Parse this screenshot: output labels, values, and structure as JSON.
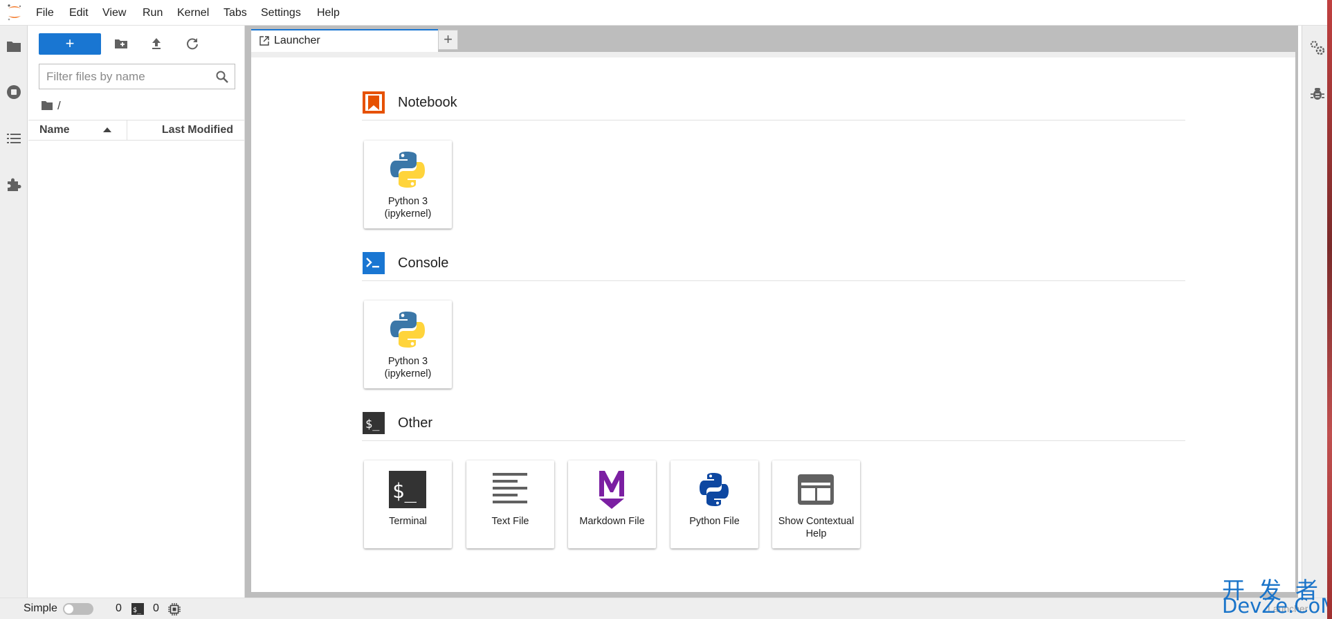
{
  "menubar": {
    "items": [
      "File",
      "Edit",
      "View",
      "Run",
      "Kernel",
      "Tabs",
      "Settings",
      "Help"
    ]
  },
  "file_browser": {
    "new_button_label": "+",
    "filter_placeholder": "Filter files by name",
    "breadcrumb": "/",
    "columns": {
      "name": "Name",
      "last_modified": "Last Modified"
    }
  },
  "tabs": [
    {
      "label": "Launcher",
      "active": true
    }
  ],
  "add_tab_label": "+",
  "launcher": {
    "sections": [
      {
        "title": "Notebook",
        "cards": [
          {
            "label": "Python 3\n(ipykernel)",
            "icon": "python-logo-icon"
          }
        ]
      },
      {
        "title": "Console",
        "cards": [
          {
            "label": "Python 3\n(ipykernel)",
            "icon": "python-logo-icon"
          }
        ]
      },
      {
        "title": "Other",
        "cards": [
          {
            "label": "Terminal",
            "icon": "terminal-icon"
          },
          {
            "label": "Text File",
            "icon": "text-file-icon"
          },
          {
            "label": "Markdown File",
            "icon": "markdown-icon"
          },
          {
            "label": "Python File",
            "icon": "python-file-icon"
          },
          {
            "label": "Show Contextual\nHelp",
            "icon": "contextual-help-icon"
          }
        ]
      }
    ]
  },
  "statusbar": {
    "simple_label": "Simple",
    "simple_enabled": false,
    "kernels_count": "0",
    "terminals_count": "0",
    "current_tab": "Launcher"
  },
  "watermark": {
    "cn": "开发者",
    "en": "DevZe.CoM"
  },
  "colors": {
    "accent": "#1976d2",
    "notebook_orange": "#e65100",
    "console_blue": "#1976d2",
    "terminal_dark": "#333333",
    "markdown_purple": "#7b1fa2",
    "python_blue": "#0d47a1"
  }
}
